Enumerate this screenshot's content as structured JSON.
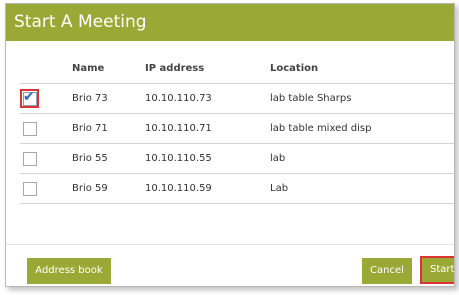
{
  "dialog": {
    "title": "Start A Meeting"
  },
  "table": {
    "columns": [
      "Name",
      "IP address",
      "Location"
    ],
    "rows": [
      {
        "checked": true,
        "name": "Brio 73",
        "ip": "10.10.110.73",
        "location": "lab table Sharps"
      },
      {
        "checked": false,
        "name": "Brio 71",
        "ip": "10.10.110.71",
        "location": "lab table mixed disp"
      },
      {
        "checked": false,
        "name": "Brio 55",
        "ip": "10.10.110.55",
        "location": "lab"
      },
      {
        "checked": false,
        "name": "Brio 59",
        "ip": "10.10.110.59",
        "location": "Lab"
      }
    ]
  },
  "buttons": {
    "address_book": "Address book",
    "cancel": "Cancel",
    "start": "Start"
  },
  "colors": {
    "accent": "#9aa935",
    "highlight": "#dd3333",
    "checkmark": "#2a69b3"
  },
  "icons": {
    "checkmark": "checkmark-icon"
  }
}
